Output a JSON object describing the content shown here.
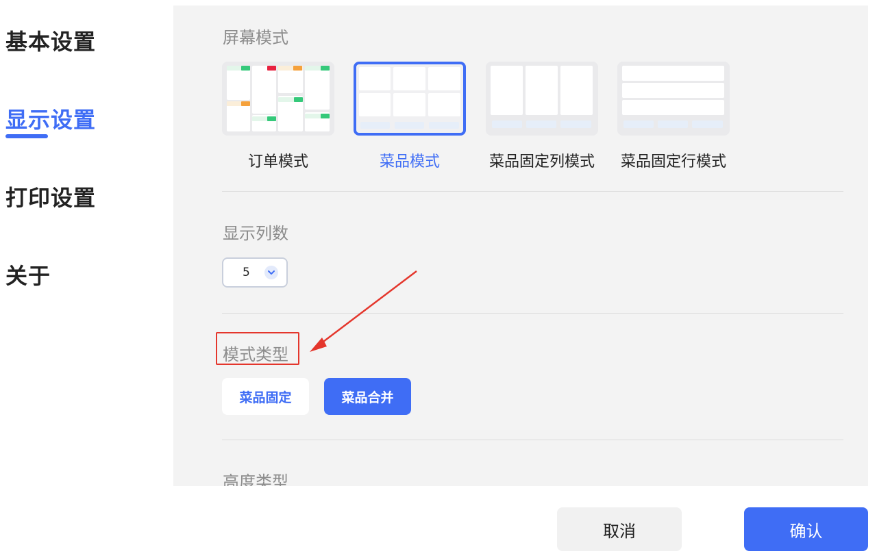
{
  "nav": {
    "items": [
      {
        "label": "基本设置"
      },
      {
        "label": "显示设置",
        "active": true
      },
      {
        "label": "打印设置"
      },
      {
        "label": "关于"
      }
    ]
  },
  "screen_mode": {
    "title": "屏幕模式",
    "options": [
      {
        "label": "订单模式"
      },
      {
        "label": "菜品模式",
        "selected": true
      },
      {
        "label": "菜品固定列模式"
      },
      {
        "label": "菜品固定行模式"
      }
    ]
  },
  "columns": {
    "title": "显示列数",
    "value": "5"
  },
  "mode_type": {
    "title": "模式类型",
    "options": [
      {
        "label": "菜品固定",
        "selected": false
      },
      {
        "label": "菜品合并",
        "selected": true
      }
    ]
  },
  "height_type": {
    "title": "高度类型"
  },
  "footer": {
    "cancel_label": "取消",
    "confirm_label": "确认"
  },
  "colors": {
    "accent": "#3f6df5",
    "annotation": "#e4362c",
    "tag_green": "#35c97a",
    "tag_red": "#e8213f",
    "tag_orange": "#f5a13b"
  }
}
